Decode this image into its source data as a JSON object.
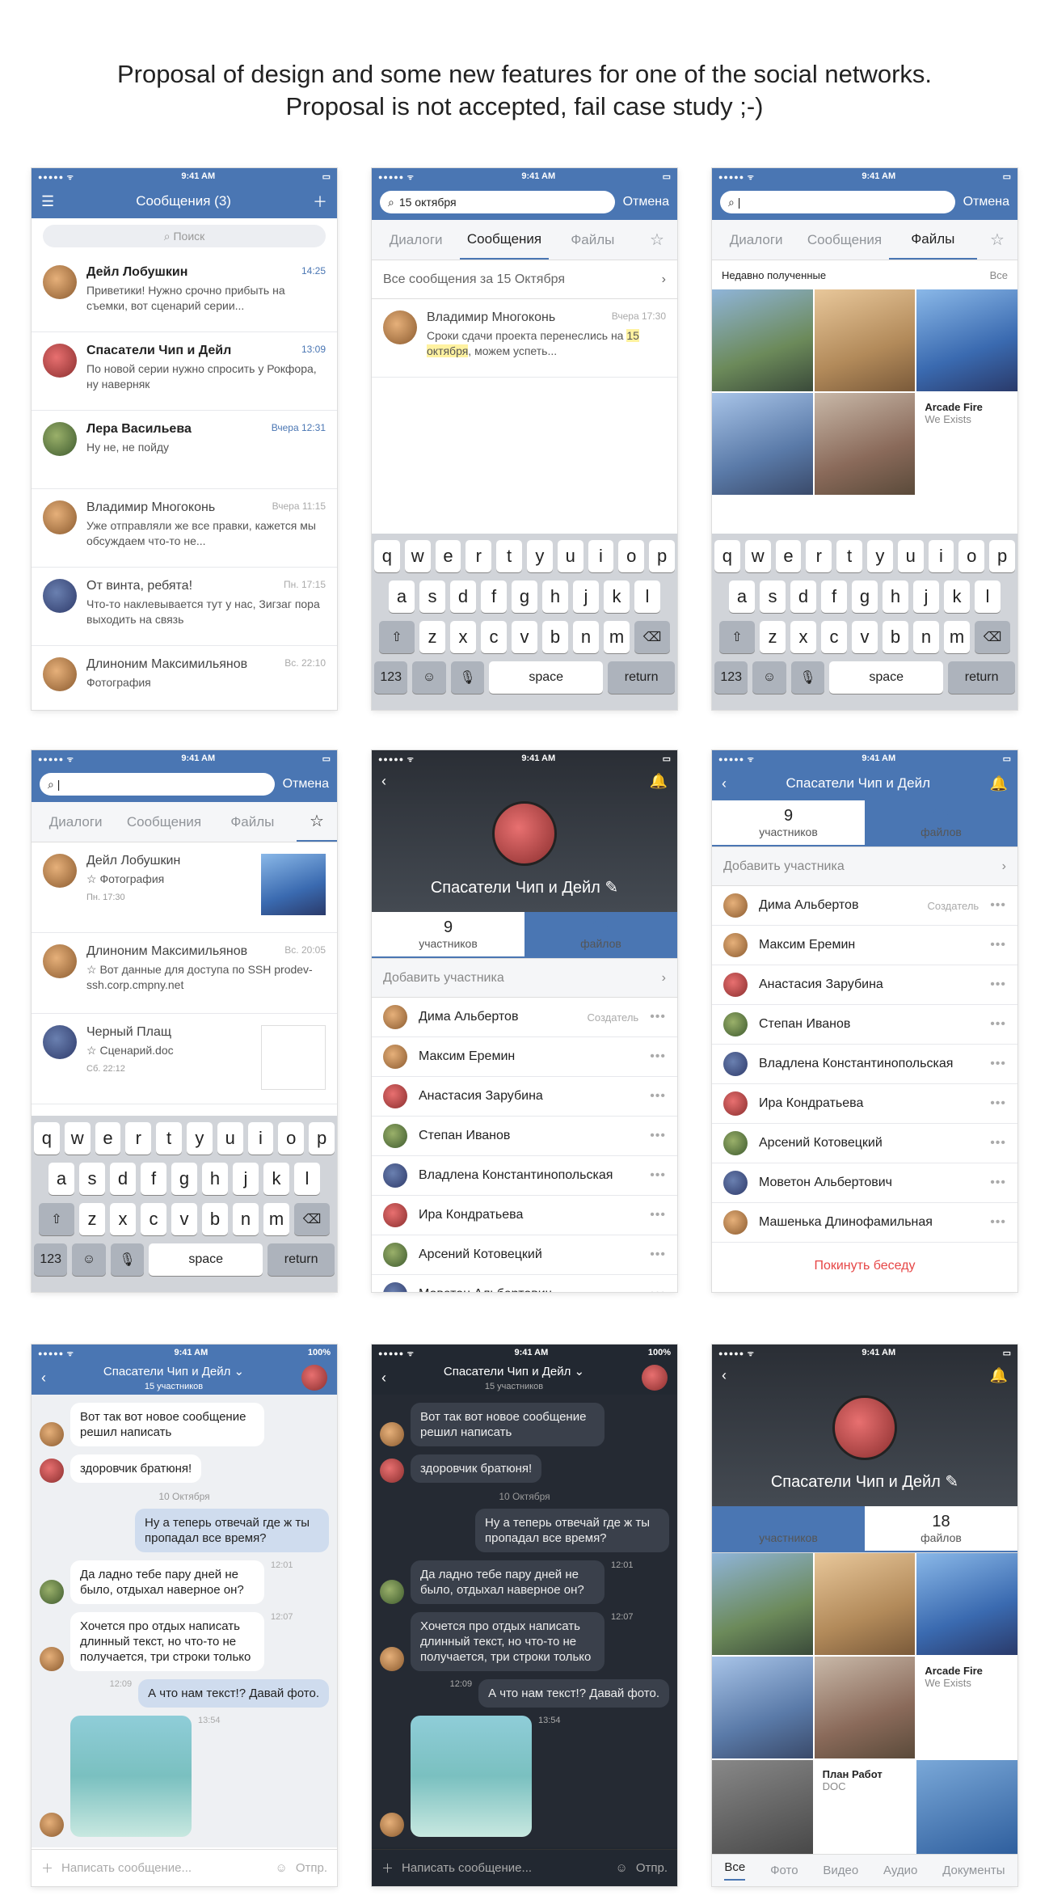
{
  "header": {
    "line1": "Proposal of design and some new features for one of the social networks.",
    "line2": "Proposal is not accepted, fail case study ;-)"
  },
  "time": "9:41 AM",
  "battery": "100%",
  "p1": {
    "title": "Сообщения (3)",
    "search": "Поиск",
    "items": [
      {
        "name": "Дейл Лобушкин",
        "time": "14:25",
        "text": "Приветики! Нужно срочно прибыть на съемки, вот сценарий серии..."
      },
      {
        "name": "Спасатели Чип и Дейл",
        "time": "13:09",
        "text": "По новой серии нужно спросить у Рокфора, ну наверняк"
      },
      {
        "name": "Лера Васильева",
        "time": "Вчера 12:31",
        "text": "Ну не, не пойду"
      },
      {
        "name": "Владимир Многоконь",
        "time": "Вчера 11:15",
        "text": "Уже отправляли же все правки, кажется мы обсуждаем что-то не..."
      },
      {
        "name": "От винта, ребята!",
        "time": "Пн. 17:15",
        "text": "Что-то наклевывается тут у нас, Зигзаг пора выходить на связь"
      },
      {
        "name": "Длиноним Максимильянов",
        "time": "Вс. 22:10",
        "text": "Фотография"
      }
    ]
  },
  "p2": {
    "query": "15 октября",
    "cancel": "Отмена",
    "tabs": [
      "Диалоги",
      "Сообщения",
      "Файлы"
    ],
    "all": "Все сообщения за 15 Октября",
    "name": "Владимир Многоконь",
    "time": "Вчера 17:30",
    "text1": "Сроки сдачи проекта перенеслись на ",
    "hl": "15 октября",
    "text2": ", можем успеть..."
  },
  "kbd": {
    "r1": [
      "q",
      "w",
      "e",
      "r",
      "t",
      "y",
      "u",
      "i",
      "o",
      "p"
    ],
    "r2": [
      "a",
      "s",
      "d",
      "f",
      "g",
      "h",
      "j",
      "k",
      "l"
    ],
    "r3": [
      "z",
      "x",
      "c",
      "v",
      "b",
      "n",
      "m"
    ],
    "num": "123",
    "space": "space",
    "ret": "return"
  },
  "p3": {
    "recent": "Недавно полученные",
    "all": "Все",
    "arcade": "Arcade Fire",
    "exists": "We Exists",
    "plan": "План Работ",
    "doc": "DOC"
  },
  "p4": {
    "items": [
      {
        "name": "Дейл Лобушкин",
        "text": "Фотография",
        "time": "Пн. 17:30"
      },
      {
        "name": "Длиноним Максимильянов",
        "time": "Вс. 20:05",
        "text": "Вот данные для доступа по SSH prodev-ssh.corp.cmpny.net"
      },
      {
        "name": "Черный Плащ",
        "text": "Сценарий.doc",
        "time": "Сб. 22:12"
      }
    ]
  },
  "group": {
    "name": "Спасатели Чип и Дейл",
    "members_n": "9",
    "members": "участников",
    "files_n": "18",
    "files": "файлов",
    "add": "Добавить участника",
    "creator": "Создатель",
    "leave": "Покинуть беседу",
    "count": "15 участников"
  },
  "members": [
    "Дима Альбертов",
    "Максим Еремин",
    "Анастасия Зарубина",
    "Степан Иванов",
    "Владлена Константинопольская",
    "Ира Кондратьева",
    "Арсений Котовецкий",
    "Моветон Альбертович",
    "Машенька Длинофамильная"
  ],
  "chat": {
    "m1": "Вот так вот новое сообщение решил написать",
    "m2": "здоровчик братюня!",
    "date": "10 Октября",
    "m3": "Ну а теперь отвечай где ж ты пропадал все время?",
    "m4": "Да ладно тебе пару дней не было, отдыхал наверное он?",
    "t4": "12:01",
    "m5": "Хочется про отдых написать длинный текст, но что-то не получается, три строки только",
    "t5": "12:07",
    "m6": "А что нам текст!? Давай фото.",
    "t6": "12:09",
    "t7": "13:54",
    "input": "Написать сообщение...",
    "send": "Отпр."
  },
  "bottomtabs": [
    "Все",
    "Фото",
    "Видео",
    "Аудио",
    "Документы"
  ]
}
